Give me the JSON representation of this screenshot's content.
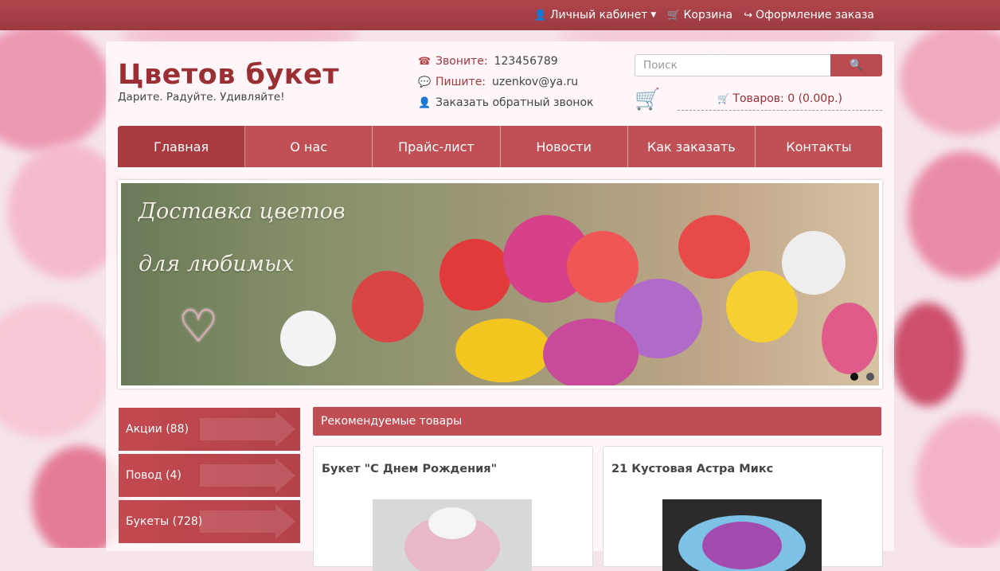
{
  "topbar": {
    "account_label": "Личный кабинет",
    "cart_label": "Корзина",
    "checkout_label": "Оформление заказа"
  },
  "brand": {
    "title": "Цветов букет",
    "tagline": "Дарите. Радуйте. Удивляйте!"
  },
  "contacts": {
    "phone_label": "Звоните:",
    "phone": "123456789",
    "email_label": "Пишите:",
    "email": "uzenkov@ya.ru",
    "callback": "Заказать обратный звонок"
  },
  "search": {
    "placeholder": "Поиск"
  },
  "cart": {
    "summary": "Товаров: 0 (0.00р.)"
  },
  "nav": {
    "items": [
      "Главная",
      "О нас",
      "Прайс-лист",
      "Новости",
      "Как заказать",
      "Контакты"
    ]
  },
  "slider": {
    "caption_line1": "Доставка цветов",
    "caption_line2": "для любимых",
    "active_slide": 1,
    "slide_count": 2
  },
  "categories": [
    {
      "label": "Акции (88)"
    },
    {
      "label": "Повод (4)"
    },
    {
      "label": "Букеты (728)"
    }
  ],
  "recommended": {
    "heading": "Рекомендуемые товары",
    "products": [
      {
        "name": "Букет \"С Днем Рождения\""
      },
      {
        "name": "21 Кустовая Астра Микс"
      }
    ]
  },
  "colors": {
    "accent": "#b94a50",
    "brand": "#9a2f34",
    "nav_active": "#a83a40"
  }
}
